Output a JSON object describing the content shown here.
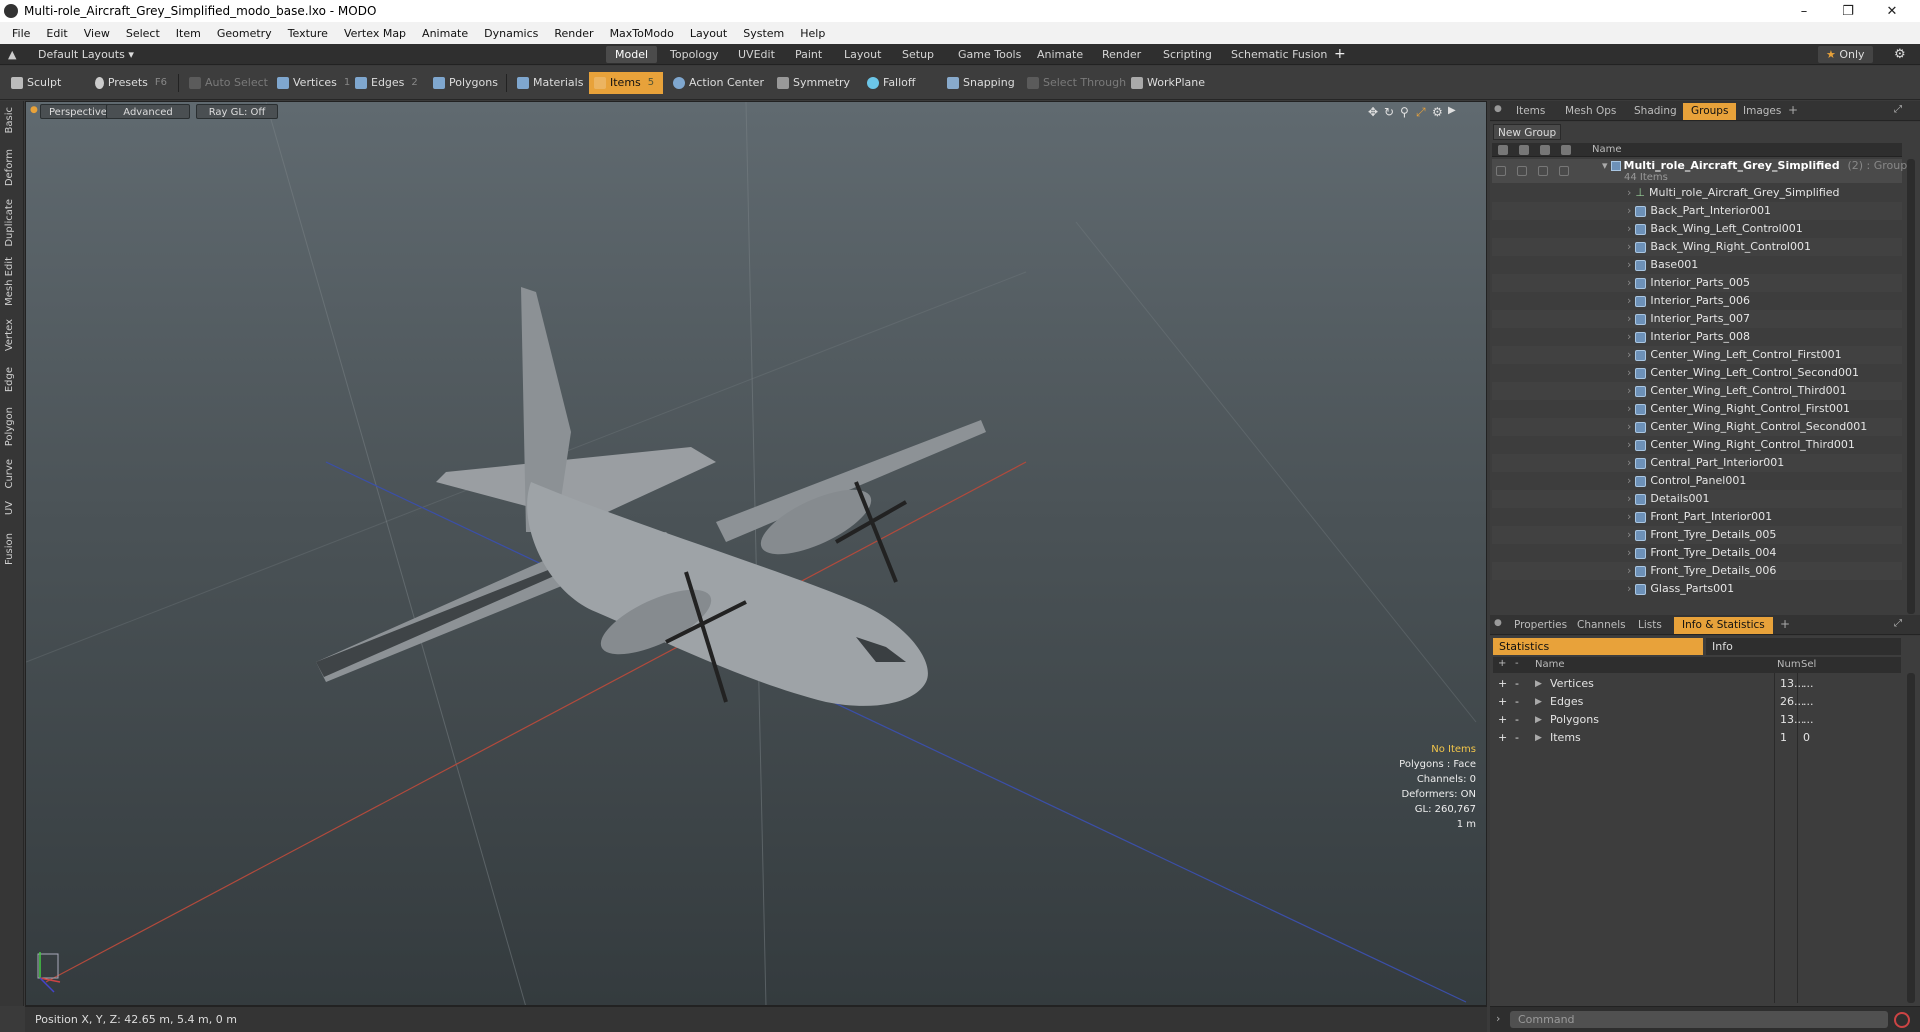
{
  "window": {
    "title": "Multi-role_Aircraft_Grey_Simplified_modo_base.lxo - MODO"
  },
  "menu": [
    "File",
    "Edit",
    "View",
    "Select",
    "Item",
    "Geometry",
    "Texture",
    "Vertex Map",
    "Animate",
    "Dynamics",
    "Render",
    "MaxToModo",
    "Layout",
    "System",
    "Help"
  ],
  "layoutbar": {
    "layouts_label": "Default Layouts",
    "tabs": [
      "Model",
      "Topology",
      "UVEdit",
      "Paint",
      "Layout",
      "Setup",
      "Game Tools",
      "Animate",
      "Render",
      "Scripting",
      "Schematic Fusion"
    ],
    "active": "Model",
    "only_label": "Only"
  },
  "toolbar": {
    "sculpt": "Sculpt",
    "presets": "Presets",
    "presets_key": "F6",
    "auto_select": "Auto Select",
    "vertices": "Vertices",
    "vertices_key": "1",
    "edges": "Edges",
    "edges_key": "2",
    "polygons": "Polygons",
    "materials": "Materials",
    "items": "Items",
    "items_key": "5",
    "action_center": "Action Center",
    "symmetry": "Symmetry",
    "falloff": "Falloff",
    "snapping": "Snapping",
    "select_through": "Select Through",
    "workplane": "WorkPlane"
  },
  "left_tabs": [
    "Basic",
    "Deform",
    "Duplicate",
    "Mesh Edit",
    "Vertex",
    "Edge",
    "Polygon",
    "Curve",
    "UV",
    "Fusion"
  ],
  "viewport": {
    "perspective": "Perspective",
    "advanced": "Advanced",
    "raygl": "Ray GL: Off",
    "info": {
      "no_items": "No Items",
      "polygons": "Polygons : Face",
      "channels": "Channels: 0",
      "deformers": "Deformers: ON",
      "gl": "GL: 260,767",
      "scale": "1 m"
    }
  },
  "statusbar": {
    "position": "Position X, Y, Z:  42.65 m, 5.4 m, 0 m"
  },
  "groups_panel": {
    "tabs": [
      "Items",
      "Mesh Ops",
      "Shading",
      "Groups",
      "Images"
    ],
    "active": "Groups",
    "new_group": "New Group",
    "col_name": "Name",
    "group_name": "Multi_role_Aircraft_Grey_Simplified",
    "group_suffix": "(2) : Group",
    "group_count": "44 Items",
    "items": [
      "Multi_role_Aircraft_Grey_Simplified",
      "Back_Part_Interior001",
      "Back_Wing_Left_Control001",
      "Back_Wing_Right_Control001",
      "Base001",
      "Interior_Parts_005",
      "Interior_Parts_006",
      "Interior_Parts_007",
      "Interior_Parts_008",
      "Center_Wing_Left_Control_First001",
      "Center_Wing_Left_Control_Second001",
      "Center_Wing_Left_Control_Third001",
      "Center_Wing_Right_Control_First001",
      "Center_Wing_Right_Control_Second001",
      "Center_Wing_Right_Control_Third001",
      "Central_Part_Interior001",
      "Control_Panel001",
      "Details001",
      "Front_Part_Interior001",
      "Front_Tyre_Details_005",
      "Front_Tyre_Details_004",
      "Front_Tyre_Details_006",
      "Glass_Parts001"
    ]
  },
  "stats_panel": {
    "tabs": [
      "Properties",
      "Channels",
      "Lists",
      "Info & Statistics"
    ],
    "active": "Info & Statistics",
    "sub_statistics": "Statistics",
    "sub_info": "Info",
    "col_name": "Name",
    "col_num": "Num",
    "col_sel": "Sel",
    "rows": [
      {
        "name": "Vertices",
        "num": "13...",
        "sel": "..."
      },
      {
        "name": "Edges",
        "num": "26...",
        "sel": "..."
      },
      {
        "name": "Polygons",
        "num": "13...",
        "sel": "..."
      },
      {
        "name": "Items",
        "num": "1",
        "sel": "0"
      }
    ]
  },
  "command": {
    "placeholder": "Command"
  }
}
